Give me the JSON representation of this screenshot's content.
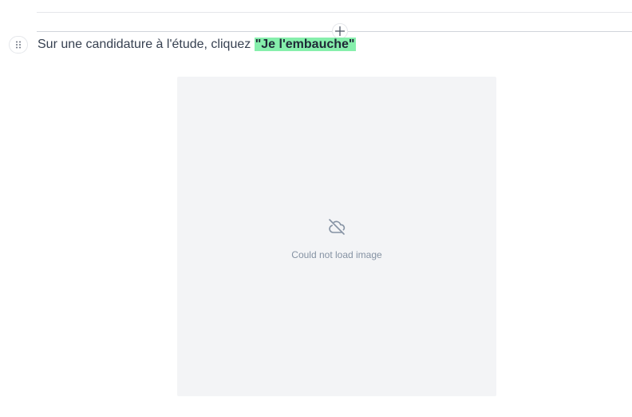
{
  "editor": {
    "add_block_icon": "plus-icon",
    "drag_handle_icon": "drag-dots-icon"
  },
  "step": {
    "text_before": "Sur une candidature à l'étude, cliquez ",
    "highlight_text": "\"Je l'embauche\"",
    "highlight_color": "#86efac"
  },
  "image_block": {
    "error_icon": "cloud-off-icon",
    "error_message": "Could not load image",
    "background": "#f3f4f6"
  }
}
